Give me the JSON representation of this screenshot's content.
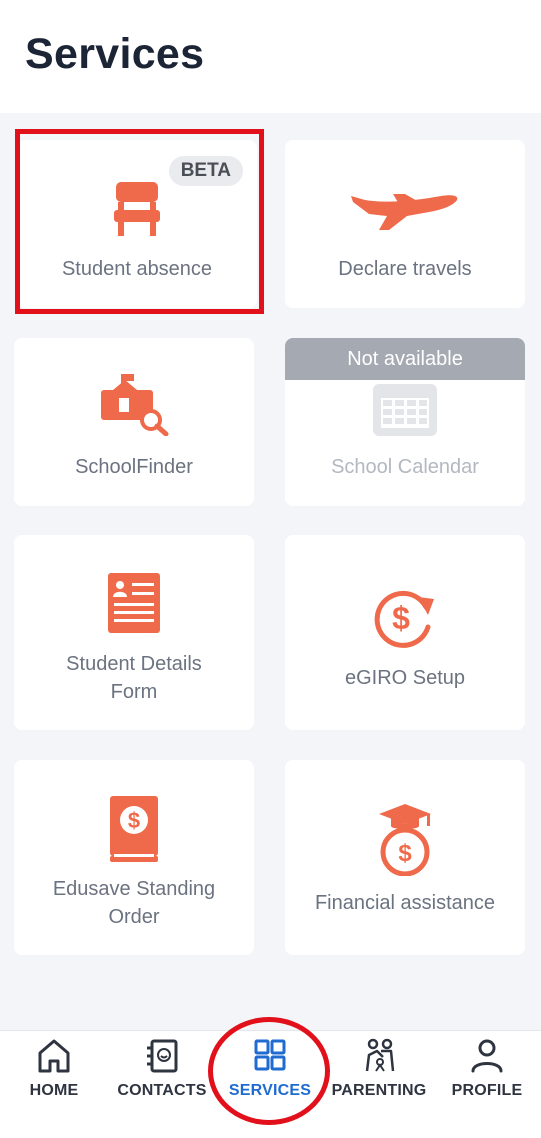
{
  "header": {
    "title": "Services"
  },
  "services": [
    {
      "label": "Student absence",
      "badge": "BETA",
      "icon": "chair-icon"
    },
    {
      "label": "Declare travels",
      "icon": "airplane-icon"
    },
    {
      "label": "SchoolFinder",
      "icon": "school-search-icon"
    },
    {
      "label": "School Calendar",
      "status": "Not available",
      "icon": "calendar-icon"
    },
    {
      "label_line1": "Student Details",
      "label_line2": "Form",
      "icon": "form-icon"
    },
    {
      "label": "eGIRO Setup",
      "icon": "dollar-refresh-icon"
    },
    {
      "label_line1": "Edusave Standing",
      "label_line2": "Order",
      "icon": "dollar-book-icon"
    },
    {
      "label": "Financial assistance",
      "icon": "graduation-money-bag-icon"
    }
  ],
  "bottom_nav": [
    {
      "label": "HOME",
      "icon": "home-icon"
    },
    {
      "label": "CONTACTS",
      "icon": "contacts-icon"
    },
    {
      "label": "SERVICES",
      "icon": "grid-icon",
      "active": true
    },
    {
      "label": "PARENTING",
      "icon": "parenting-icon"
    },
    {
      "label": "PROFILE",
      "icon": "person-icon"
    }
  ],
  "colors": {
    "accent": "#ef6a4a",
    "active_nav": "#1f6bd0",
    "highlight": "#e2101b",
    "background": "#f3f5f9"
  }
}
